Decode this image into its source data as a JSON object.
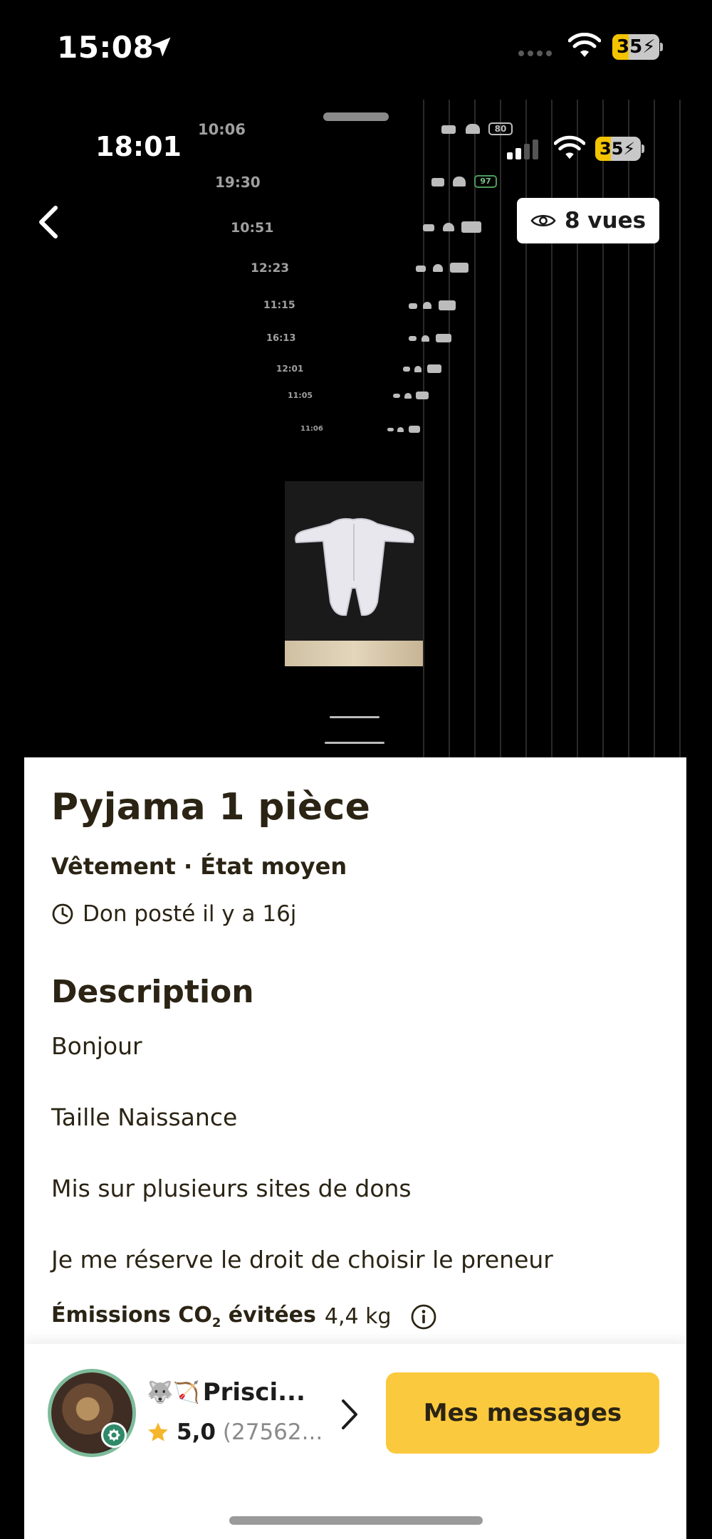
{
  "status_bar": {
    "time": "15:08",
    "battery": "35"
  },
  "photo_overlay": {
    "inner_time": "18:01",
    "inner_battery": "35",
    "views": "8 vues",
    "stacked_screens": [
      {
        "time": "10:06",
        "batt": "80"
      },
      {
        "time": "19:30",
        "batt": "97"
      },
      {
        "time": "10:51",
        "batt": ""
      },
      {
        "time": "12:23",
        "batt": ""
      },
      {
        "time": "11:15",
        "batt": ""
      },
      {
        "time": "16:13",
        "batt": ""
      },
      {
        "time": "12:01",
        "batt": ""
      },
      {
        "time": "11:05",
        "batt": ""
      },
      {
        "time": "11:06",
        "batt": ""
      }
    ]
  },
  "listing": {
    "title": "Pyjama 1 pièce",
    "subtitle": "Vêtement · État moyen",
    "posted": "Don posté il y a 16j",
    "description_heading": "Description",
    "description_lines": [
      "Bonjour",
      "Taille Naissance",
      "Mis sur plusieurs sites de dons",
      "Je me réserve le droit de choisir le preneur"
    ],
    "co2_label_main": "Émissions CO",
    "co2_label_sub": "2",
    "co2_label_end": " évitées",
    "co2_value": "4,4 kg"
  },
  "user": {
    "emoji": "🐺🏹",
    "name": "Prisci...",
    "rating": "5,0",
    "count": "(27562..."
  },
  "actions": {
    "messages_label": "Mes messages"
  },
  "colors": {
    "accent": "#fbc93d",
    "text_dark": "#2b2414",
    "badge_green": "#2f8a6a",
    "star": "#f5b62b"
  }
}
